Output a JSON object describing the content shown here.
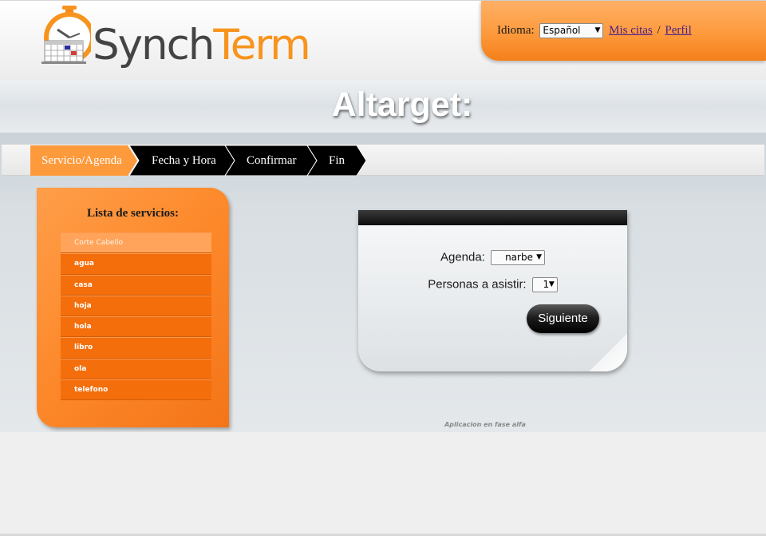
{
  "header": {
    "logo": {
      "word_dark": "Synch",
      "word_accent": "Term",
      "accent_color": "#f7941d"
    },
    "language_label": "Idioma:",
    "language_selected": "Español",
    "links": {
      "my_appointments": "Mis citas",
      "separator": "/",
      "profile": "Perfil"
    }
  },
  "page_title": "Altarget:",
  "steps": [
    {
      "label": "Servicio/Agenda",
      "active": true
    },
    {
      "label": "Fecha y Hora",
      "active": false
    },
    {
      "label": "Confirmar",
      "active": false
    },
    {
      "label": "Fin",
      "active": false
    }
  ],
  "services": {
    "title": "Lista de servicios:",
    "items": [
      {
        "label": "Corte Cabello",
        "selected": true
      },
      {
        "label": "agua",
        "selected": false
      },
      {
        "label": "casa",
        "selected": false
      },
      {
        "label": "hoja",
        "selected": false
      },
      {
        "label": "hola",
        "selected": false
      },
      {
        "label": "libro",
        "selected": false
      },
      {
        "label": "ola",
        "selected": false
      },
      {
        "label": "telefono",
        "selected": false
      }
    ]
  },
  "form": {
    "agenda_label": "Agenda:",
    "agenda_value": "narbe",
    "persons_label": "Personas a asistir:",
    "persons_value": "1",
    "next_label": "Siguiente"
  },
  "footer_note": "Aplicacion en fase alfa",
  "colors": {
    "orange": "#fd8a2c",
    "orange_dark": "#f46e0c",
    "step_active": "#fd9a3c",
    "step_inactive": "#000000"
  }
}
